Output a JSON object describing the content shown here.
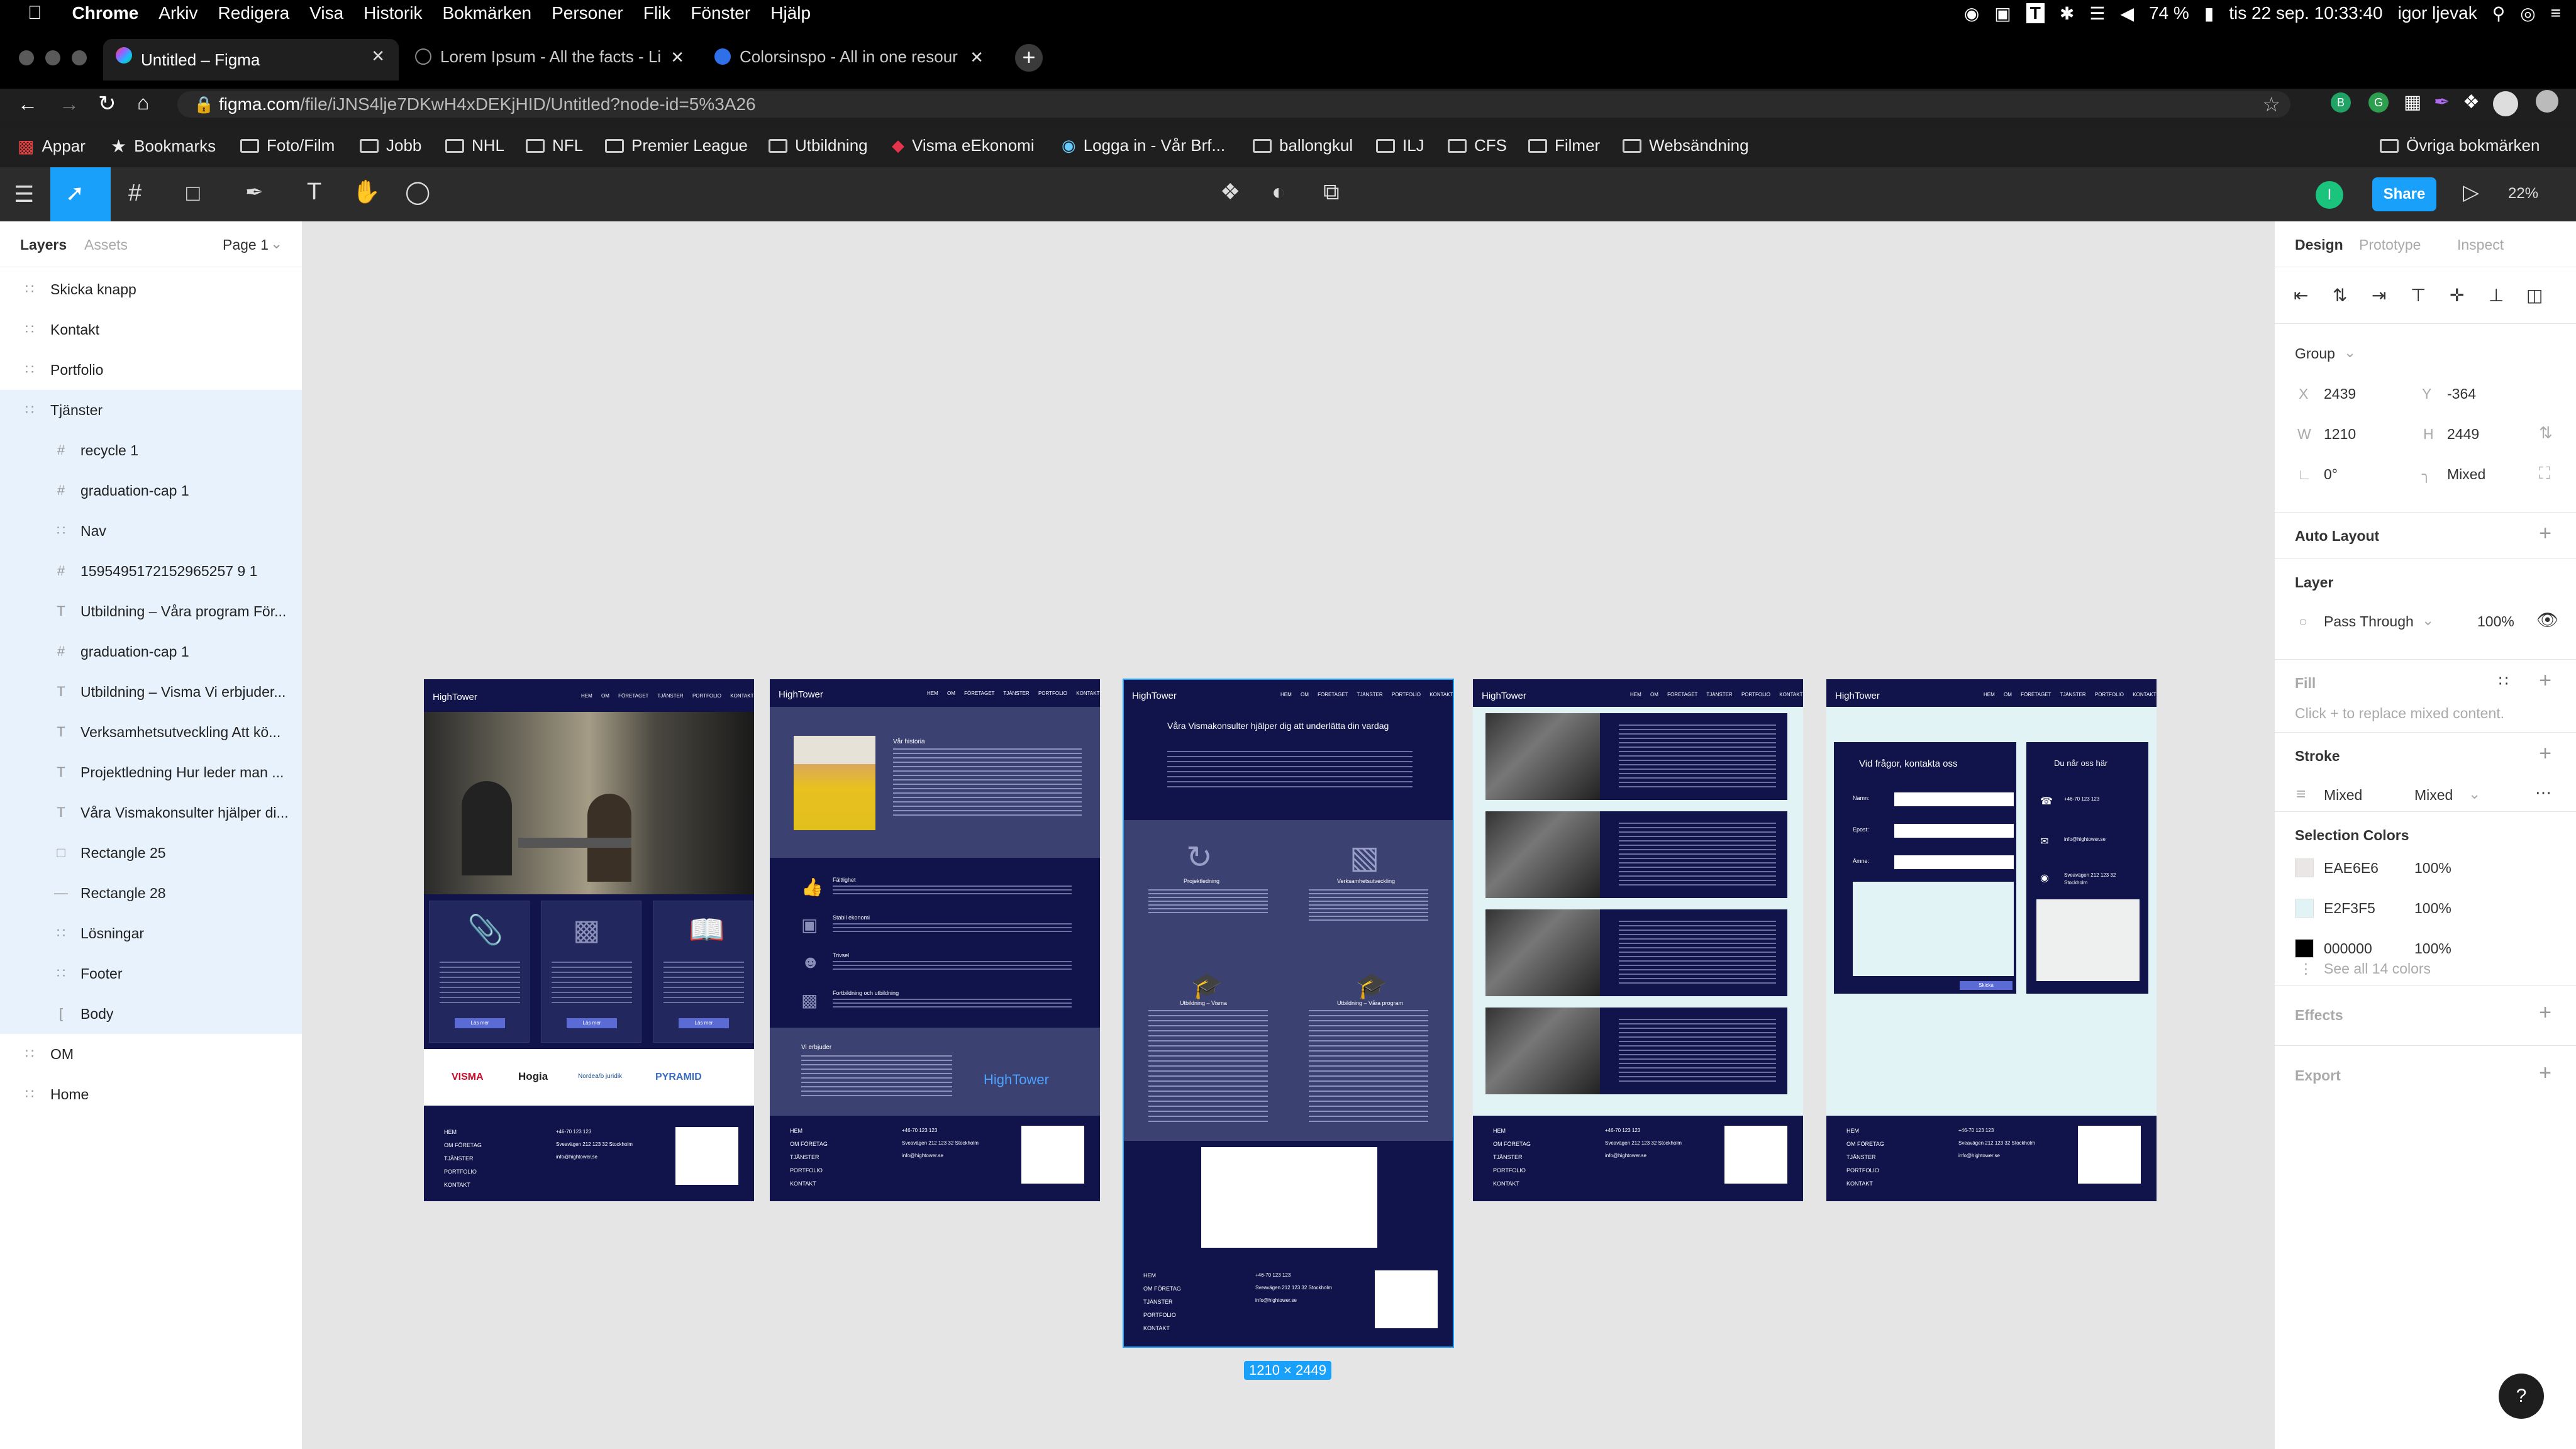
{
  "menubar": {
    "app": "Chrome",
    "menus": [
      "Arkiv",
      "Redigera",
      "Visa",
      "Historik",
      "Bokmärken",
      "Personer",
      "Flik",
      "Fönster",
      "Hjälp"
    ],
    "battery": "74 %",
    "datetime": "tis 22 sep. 10:33:40",
    "user": "igor ljevak"
  },
  "tabs": [
    {
      "title": "Untitled – Figma",
      "active": true
    },
    {
      "title": "Lorem Ipsum - All the facts - Li",
      "active": false
    },
    {
      "title": "Colorsinspo - All in one resour",
      "active": false
    }
  ],
  "address": {
    "host": "figma.com",
    "path": "/file/iJNS4lje7DKwH4xDEKjHID/Untitled?node-id=5%3A26"
  },
  "bookmarks": [
    "Appar",
    "Bookmarks",
    "Foto/Film",
    "Jobb",
    "NHL",
    "NFL",
    "Premier League",
    "Utbildning",
    "Visma eEkonomi",
    "Logga in - Vår Brf...",
    "ballongkul",
    "ILJ",
    "CFS",
    "Filmer",
    "Websändning"
  ],
  "other_bookmarks": "Övriga bokmärken",
  "figma_toolbar": {
    "avatar": "I",
    "share": "Share",
    "zoom": "22%"
  },
  "left_panel": {
    "tabs": [
      "Layers",
      "Assets"
    ],
    "page": "Page 1",
    "layers": [
      {
        "name": "Skicka knapp",
        "icon": "frame",
        "indent": 0,
        "selected": false
      },
      {
        "name": "Kontakt",
        "icon": "frame",
        "indent": 0,
        "selected": false
      },
      {
        "name": "Portfolio",
        "icon": "frame",
        "indent": 0,
        "selected": false
      },
      {
        "name": "Tjänster",
        "icon": "frame",
        "indent": 0,
        "selected": true
      },
      {
        "name": "recycle 1",
        "icon": "hash",
        "indent": 1,
        "selected": true
      },
      {
        "name": "graduation-cap 1",
        "icon": "hash",
        "indent": 1,
        "selected": true
      },
      {
        "name": "Nav",
        "icon": "frame",
        "indent": 1,
        "selected": true
      },
      {
        "name": "1595495172152965257 9 1",
        "icon": "hash",
        "indent": 1,
        "selected": true
      },
      {
        "name": "Utbildning – Våra program För...",
        "icon": "text",
        "indent": 1,
        "selected": true
      },
      {
        "name": "graduation-cap 1",
        "icon": "hash",
        "indent": 1,
        "selected": true
      },
      {
        "name": "Utbildning – Visma Vi erbjuder...",
        "icon": "text",
        "indent": 1,
        "selected": true
      },
      {
        "name": "Verksamhetsutveckling Att kö...",
        "icon": "text",
        "indent": 1,
        "selected": true
      },
      {
        "name": "Projektledning Hur leder man ...",
        "icon": "text",
        "indent": 1,
        "selected": true
      },
      {
        "name": "Våra Vismakonsulter hjälper di...",
        "icon": "text",
        "indent": 1,
        "selected": true
      },
      {
        "name": "Rectangle 25",
        "icon": "rect",
        "indent": 1,
        "selected": true
      },
      {
        "name": "Rectangle 28",
        "icon": "line",
        "indent": 1,
        "selected": true
      },
      {
        "name": "Lösningar",
        "icon": "frame",
        "indent": 1,
        "selected": true
      },
      {
        "name": "Footer",
        "icon": "frame",
        "indent": 1,
        "selected": true
      },
      {
        "name": "Body",
        "icon": "bracket",
        "indent": 1,
        "selected": true
      },
      {
        "name": "OM",
        "icon": "frame",
        "indent": 0,
        "selected": false
      },
      {
        "name": "Home",
        "icon": "frame",
        "indent": 0,
        "selected": false
      }
    ]
  },
  "right_panel": {
    "tabs": [
      "Design",
      "Prototype",
      "Inspect"
    ],
    "group_label": "Group",
    "x": "2439",
    "y": "-364",
    "w": "1210",
    "h": "2449",
    "rotation": "0°",
    "radius": "Mixed",
    "auto_layout": "Auto Layout",
    "layer_title": "Layer",
    "blend": "Pass Through",
    "opacity": "100%",
    "fill_title": "Fill",
    "fill_hint": "Click + to replace mixed content.",
    "stroke_title": "Stroke",
    "stroke_value": "Mixed",
    "stroke_weight": "Mixed",
    "selection_colors_title": "Selection Colors",
    "selection_colors": [
      {
        "hex": "EAE6E6",
        "opacity": "100%",
        "swatch": "#eae6e6"
      },
      {
        "hex": "E2F3F5",
        "opacity": "100%",
        "swatch": "#e2f3f5"
      },
      {
        "hex": "000000",
        "opacity": "100%",
        "swatch": "#000000"
      }
    ],
    "see_all": "See all 14 colors",
    "effects": "Effects",
    "export": "Export"
  },
  "canvas": {
    "size_badge": "1210 × 2449",
    "brand": "HighTower",
    "nav": [
      "HEM",
      "OM FÖRETAGET",
      "TJÄNSTER",
      "PORTFOLIO",
      "KONTAKT"
    ],
    "footer_links": [
      "HEM",
      "OM FÖRETAG",
      "TJÄNSTER",
      "PORTFOLIO",
      "KONTAKT"
    ],
    "footer_phone": "+46-70 123 123",
    "footer_address": "Sveavägen 212 123 32 Stockholm",
    "footer_email": "info@hightower.se",
    "partners": [
      "VISMA",
      "Hogia",
      "Nordea/b juridik",
      "PYRAMID"
    ],
    "about_title": "Vår historia",
    "values": [
      "Fältlighet",
      "Stabil ekonomi",
      "Trivsel",
      "Fortbildning och utbildning"
    ],
    "vi_erbjuder": "Vi erbjuder",
    "services_heading": "Våra Vismakonsulter hjälper dig att underlätta din vardag",
    "services": [
      "Projektledning",
      "Verksamhetsutveckling",
      "Utbildning – Visma",
      "Utbildning – Våra program"
    ],
    "contact_heading": "Vid frågor, kontakta oss",
    "contact_fields": [
      "Namn:",
      "Epost:",
      "Ämne:"
    ],
    "contact_send": "Skicka",
    "reach_heading": "Du når oss här",
    "card_button": "Läs mer"
  }
}
